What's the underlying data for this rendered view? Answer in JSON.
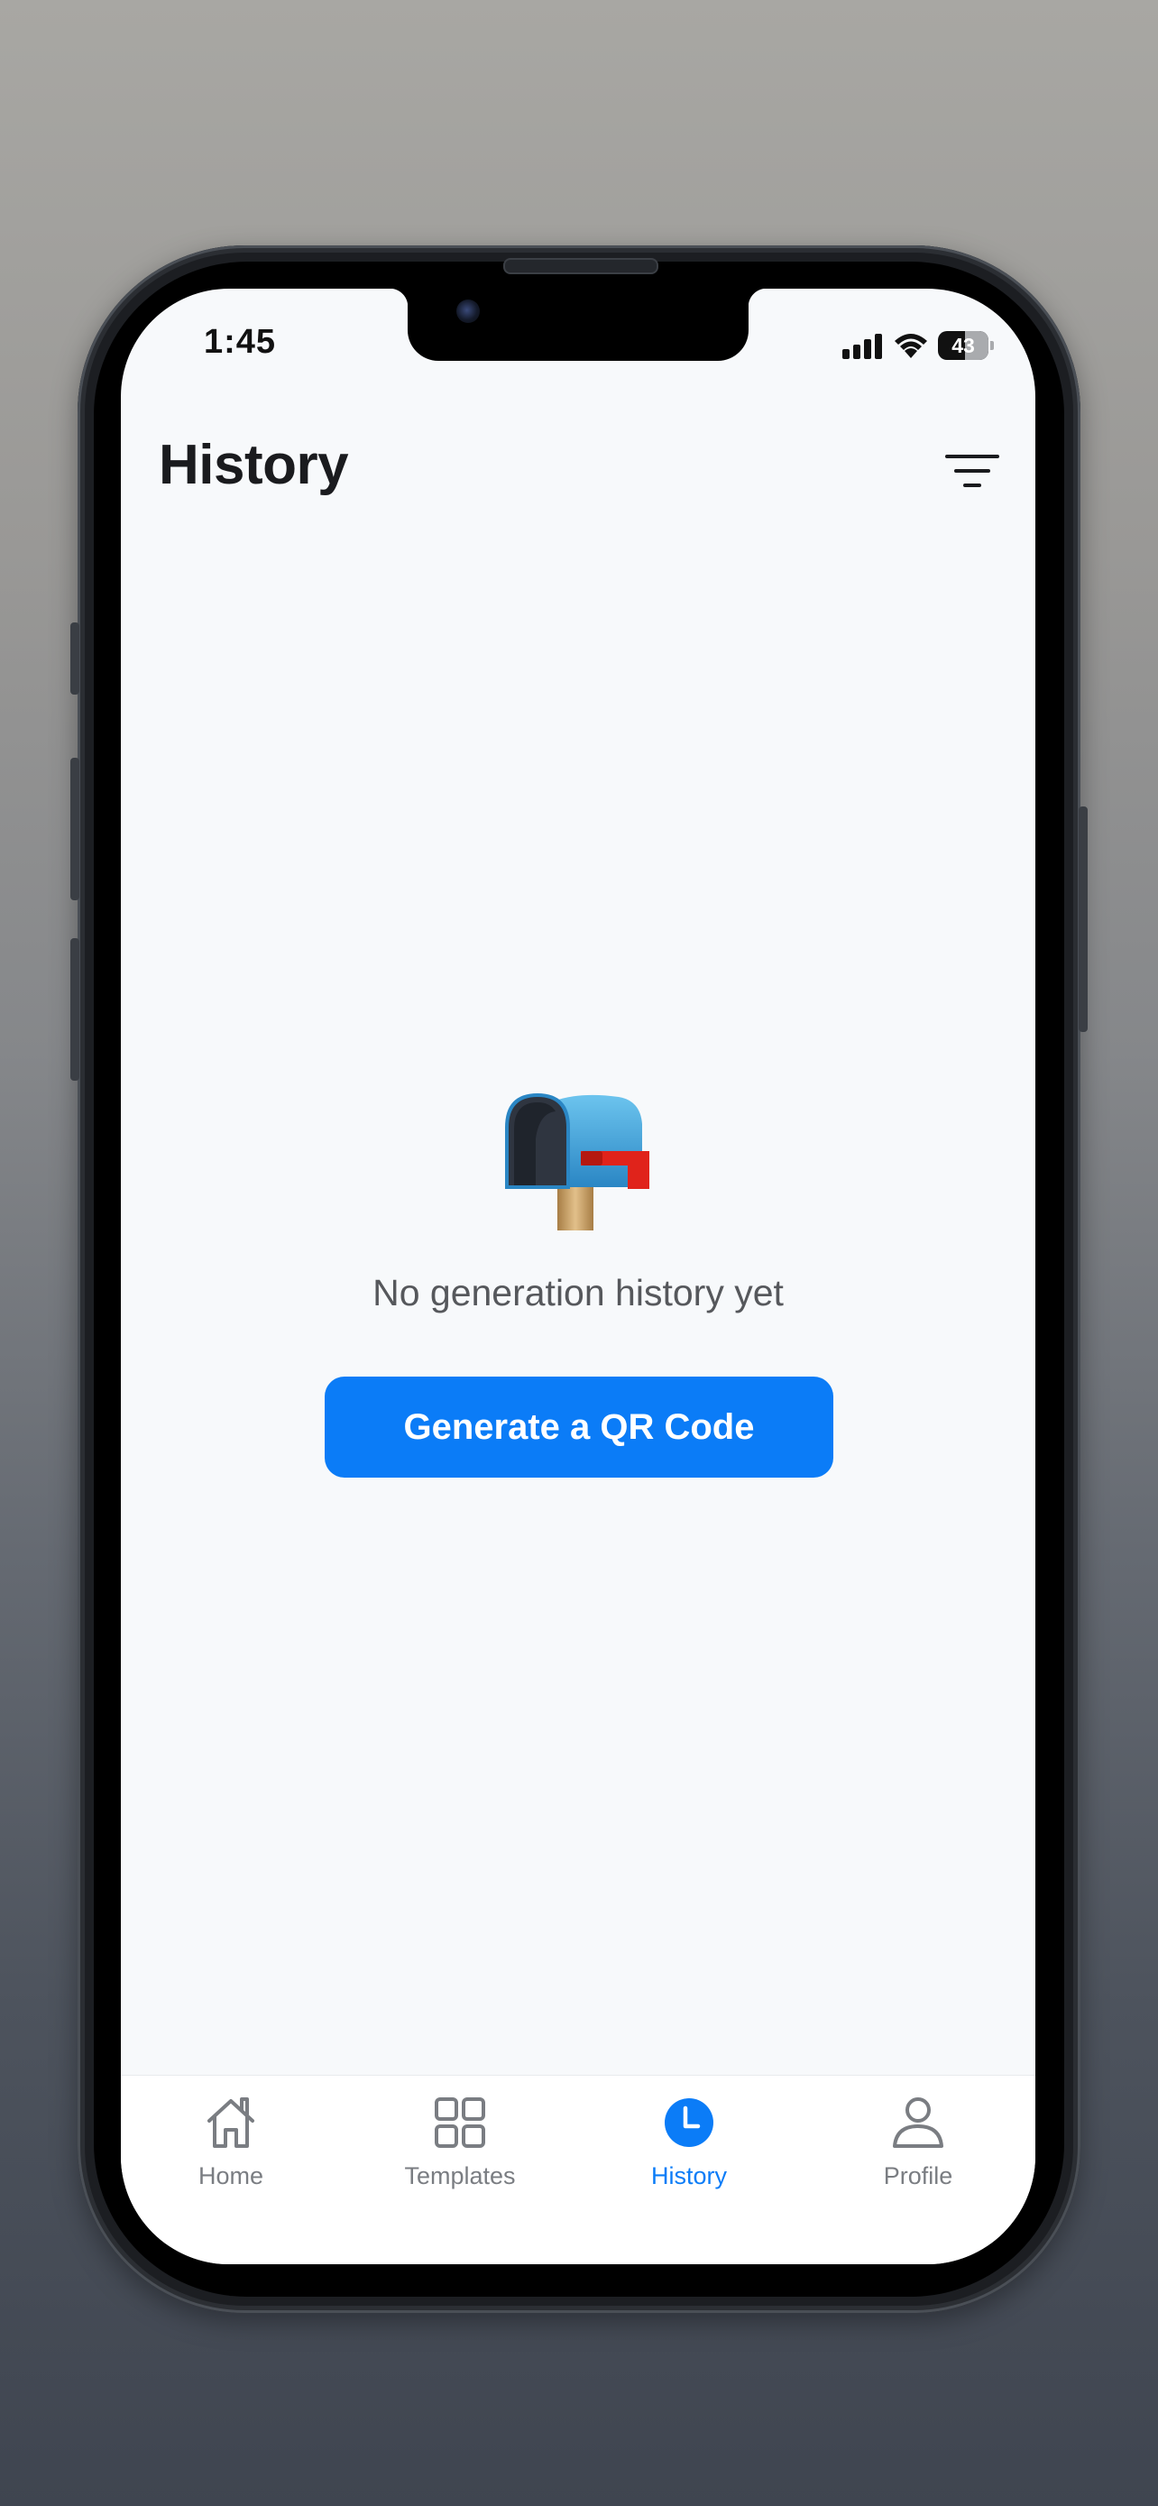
{
  "status_bar": {
    "time": "1:45",
    "battery": "43",
    "icons": [
      "cellular-signal-icon",
      "wifi-icon",
      "battery-icon"
    ]
  },
  "header": {
    "title": "History",
    "filter_icon": "filter-icon"
  },
  "empty_state": {
    "icon": "mailbox-icon",
    "message": "No generation history yet",
    "action_label": "Generate a QR Code"
  },
  "tab_bar": {
    "tabs": [
      {
        "label": "Home",
        "icon": "home-icon",
        "active": false
      },
      {
        "label": "Templates",
        "icon": "grid-icon",
        "active": false
      },
      {
        "label": "History",
        "icon": "clock-icon",
        "active": true
      },
      {
        "label": "Profile",
        "icon": "person-icon",
        "active": false
      }
    ]
  },
  "colors": {
    "accent": "#0b7cf7",
    "background": "#f7f9fb",
    "tab_inactive": "#7a7d82"
  }
}
